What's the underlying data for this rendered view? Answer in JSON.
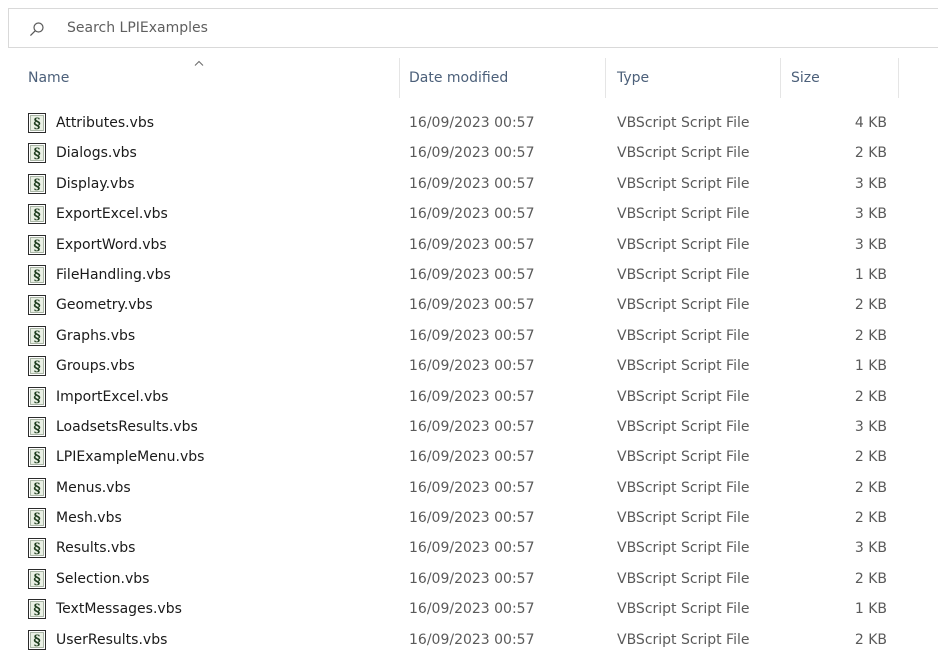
{
  "search": {
    "placeholder": "Search LPIExamples"
  },
  "columns": {
    "name": "Name",
    "date_modified": "Date modified",
    "type": "Type",
    "size": "Size"
  },
  "sort": {
    "column": "Name",
    "direction": "ascending"
  },
  "icons": {
    "search": "search-icon",
    "sort": "sort-ascending-icon",
    "file": "vbscript-file-icon"
  },
  "files": [
    {
      "name": "Attributes.vbs",
      "date": "16/09/2023 00:57",
      "type": "VBScript Script File",
      "size": "4 KB"
    },
    {
      "name": "Dialogs.vbs",
      "date": "16/09/2023 00:57",
      "type": "VBScript Script File",
      "size": "2 KB"
    },
    {
      "name": "Display.vbs",
      "date": "16/09/2023 00:57",
      "type": "VBScript Script File",
      "size": "3 KB"
    },
    {
      "name": "ExportExcel.vbs",
      "date": "16/09/2023 00:57",
      "type": "VBScript Script File",
      "size": "3 KB"
    },
    {
      "name": "ExportWord.vbs",
      "date": "16/09/2023 00:57",
      "type": "VBScript Script File",
      "size": "3 KB"
    },
    {
      "name": "FileHandling.vbs",
      "date": "16/09/2023 00:57",
      "type": "VBScript Script File",
      "size": "1 KB"
    },
    {
      "name": "Geometry.vbs",
      "date": "16/09/2023 00:57",
      "type": "VBScript Script File",
      "size": "2 KB"
    },
    {
      "name": "Graphs.vbs",
      "date": "16/09/2023 00:57",
      "type": "VBScript Script File",
      "size": "2 KB"
    },
    {
      "name": "Groups.vbs",
      "date": "16/09/2023 00:57",
      "type": "VBScript Script File",
      "size": "1 KB"
    },
    {
      "name": "ImportExcel.vbs",
      "date": "16/09/2023 00:57",
      "type": "VBScript Script File",
      "size": "2 KB"
    },
    {
      "name": "LoadsetsResults.vbs",
      "date": "16/09/2023 00:57",
      "type": "VBScript Script File",
      "size": "3 KB"
    },
    {
      "name": "LPIExampleMenu.vbs",
      "date": "16/09/2023 00:57",
      "type": "VBScript Script File",
      "size": "2 KB"
    },
    {
      "name": "Menus.vbs",
      "date": "16/09/2023 00:57",
      "type": "VBScript Script File",
      "size": "2 KB"
    },
    {
      "name": "Mesh.vbs",
      "date": "16/09/2023 00:57",
      "type": "VBScript Script File",
      "size": "2 KB"
    },
    {
      "name": "Results.vbs",
      "date": "16/09/2023 00:57",
      "type": "VBScript Script File",
      "size": "3 KB"
    },
    {
      "name": "Selection.vbs",
      "date": "16/09/2023 00:57",
      "type": "VBScript Script File",
      "size": "2 KB"
    },
    {
      "name": "TextMessages.vbs",
      "date": "16/09/2023 00:57",
      "type": "VBScript Script File",
      "size": "1 KB"
    },
    {
      "name": "UserResults.vbs",
      "date": "16/09/2023 00:57",
      "type": "VBScript Script File",
      "size": "2 KB"
    }
  ]
}
